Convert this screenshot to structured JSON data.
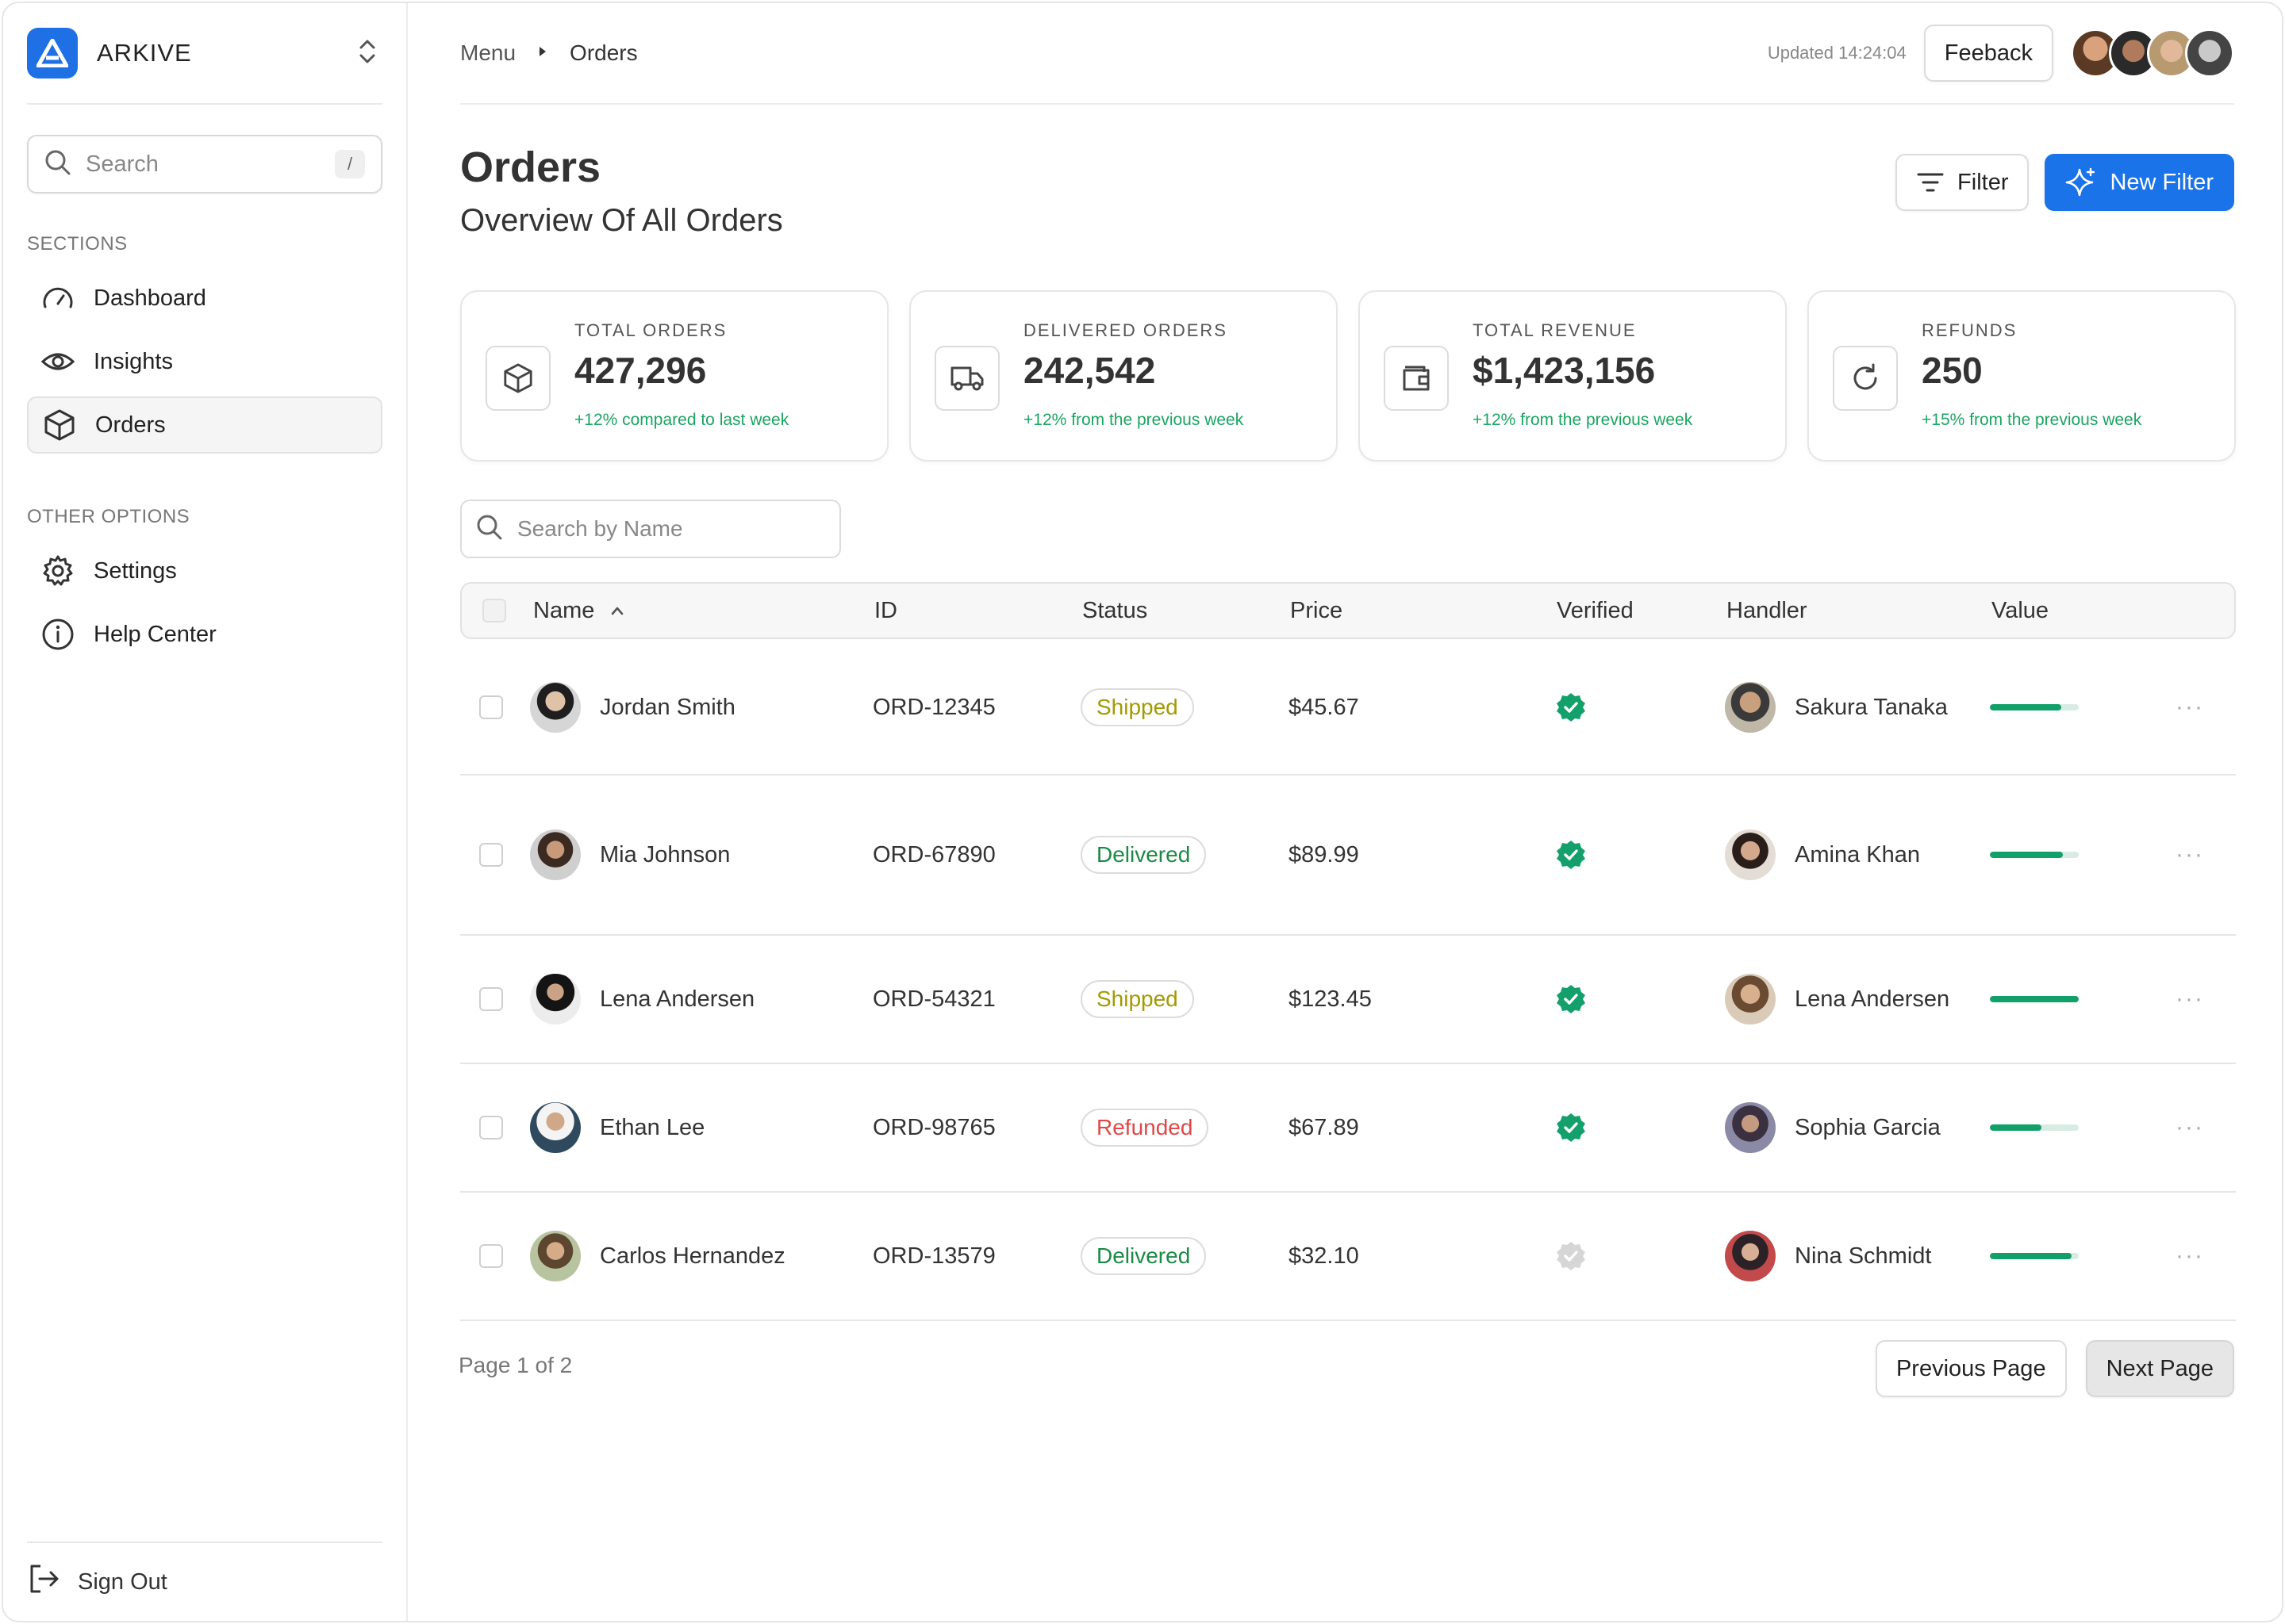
{
  "app": {
    "name": "ARKIVE"
  },
  "sidebar": {
    "search_placeholder": "Search",
    "search_shortcut": "/",
    "sections_label": "SECTIONS",
    "sections": [
      {
        "label": "Dashboard",
        "icon": "gauge-icon"
      },
      {
        "label": "Insights",
        "icon": "eye-icon"
      },
      {
        "label": "Orders",
        "icon": "box-icon",
        "active": true
      }
    ],
    "other_label": "OTHER OPTIONS",
    "other": [
      {
        "label": "Settings",
        "icon": "gear-icon"
      },
      {
        "label": "Help Center",
        "icon": "info-icon"
      }
    ],
    "sign_out": "Sign Out"
  },
  "header": {
    "breadcrumb": [
      "Menu",
      "Orders"
    ],
    "updated": "Updated 14:24:04",
    "feedback_label": "Feeback"
  },
  "page": {
    "title": "Orders",
    "subtitle": "Overview Of All Orders",
    "filter_label": "Filter",
    "new_filter_label": "New Filter"
  },
  "stats": [
    {
      "label": "TOTAL ORDERS",
      "value": "427,296",
      "delta": "+12% compared to last week",
      "icon": "box-icon"
    },
    {
      "label": "DELIVERED ORDERS",
      "value": "242,542",
      "delta": "+12% from the previous week",
      "icon": "truck-icon"
    },
    {
      "label": "TOTAL REVENUE",
      "value": "$1,423,156",
      "delta": "+12% from the previous week",
      "icon": "wallet-icon"
    },
    {
      "label": "REFUNDS",
      "value": "250",
      "delta": "+15% from the previous week",
      "icon": "refresh-icon"
    }
  ],
  "table": {
    "search_placeholder": "Search by Name",
    "columns": [
      "Name",
      "ID",
      "Status",
      "Price",
      "Verified",
      "Handler",
      "Value"
    ],
    "rows": [
      {
        "name": "Jordan Smith",
        "id": "ORD-12345",
        "status": "Shipped",
        "price": "$45.67",
        "verified": true,
        "handler": "Sakura Tanaka",
        "value": 0.8
      },
      {
        "name": "Mia Johnson",
        "id": "ORD-67890",
        "status": "Delivered",
        "price": "$89.99",
        "verified": true,
        "handler": "Amina Khan",
        "value": 0.82
      },
      {
        "name": "Lena Andersen",
        "id": "ORD-54321",
        "status": "Shipped",
        "price": "$123.45",
        "verified": true,
        "handler": "Lena Andersen",
        "value": 1.0
      },
      {
        "name": "Ethan Lee",
        "id": "ORD-98765",
        "status": "Refunded",
        "price": "$67.89",
        "verified": true,
        "handler": "Sophia Garcia",
        "value": 0.58
      },
      {
        "name": "Carlos Hernandez",
        "id": "ORD-13579",
        "status": "Delivered",
        "price": "$32.10",
        "verified": false,
        "handler": "Nina Schmidt",
        "value": 0.92
      }
    ]
  },
  "pagination": {
    "text": "Page 1 of 2",
    "prev_label": "Previous Page",
    "next_label": "Next Page"
  },
  "colors": {
    "accent": "#1a73e8",
    "success": "#1aa561",
    "verified": "#13a06a",
    "refunded": "#e04848",
    "shipped": "#a39a00"
  }
}
